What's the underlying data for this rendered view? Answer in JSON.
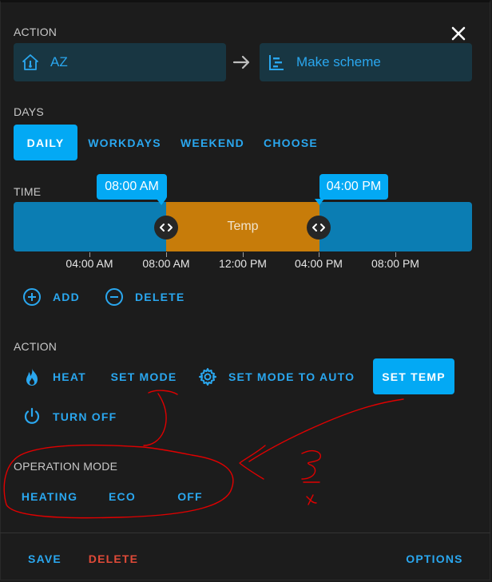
{
  "dialog": {
    "close_icon": "close-icon",
    "action_section": {
      "label": "ACTION",
      "entity": {
        "icon": "home-thermometer-icon",
        "text": "AZ"
      },
      "arrow_icon": "arrow-right-icon",
      "target": {
        "icon": "timeline-icon",
        "text": "Make scheme"
      }
    },
    "days_section": {
      "label": "DAYS",
      "options": [
        {
          "label": "DAILY",
          "selected": true
        },
        {
          "label": "WORKDAYS",
          "selected": false
        },
        {
          "label": "WEEKEND",
          "selected": false
        },
        {
          "label": "CHOOSE",
          "selected": false
        }
      ]
    },
    "time_section": {
      "label": "TIME",
      "segment_label": "Temp",
      "handles": [
        {
          "tooltip": "08:00 AM",
          "icon": "drag-horizontal-icon"
        },
        {
          "tooltip": "04:00 PM",
          "icon": "drag-horizontal-icon"
        }
      ],
      "ticks": [
        "04:00 AM",
        "08:00 AM",
        "12:00 PM",
        "04:00 PM",
        "08:00 PM"
      ],
      "add_label": "ADD",
      "add_icon": "plus-circle-icon",
      "delete_label": "DELETE",
      "delete_icon": "minus-circle-icon"
    },
    "action_buttons_section": {
      "label": "ACTION",
      "buttons": [
        {
          "label": "HEAT",
          "icon": "fire-icon"
        },
        {
          "label": "SET MODE"
        },
        {
          "label": "SET MODE TO AUTO",
          "icon": "cog-icon"
        },
        {
          "label": "SET TEMP",
          "selected": true
        },
        {
          "label": "TURN OFF",
          "icon": "power-icon"
        }
      ]
    },
    "operation_mode_section": {
      "label": "OPERATION MODE",
      "options": [
        "HEATING",
        "ECO",
        "OFF"
      ]
    },
    "footer": {
      "save_label": "SAVE",
      "delete_label": "DELETE",
      "options_label": "OPTIONS"
    },
    "colors": {
      "accent": "#03a9f4",
      "link": "#2aa7ef",
      "timeline_blue": "#0b7db3",
      "timeline_orange": "#c77c0a",
      "danger": "#e04a38",
      "annotation_red": "#e00000"
    }
  }
}
